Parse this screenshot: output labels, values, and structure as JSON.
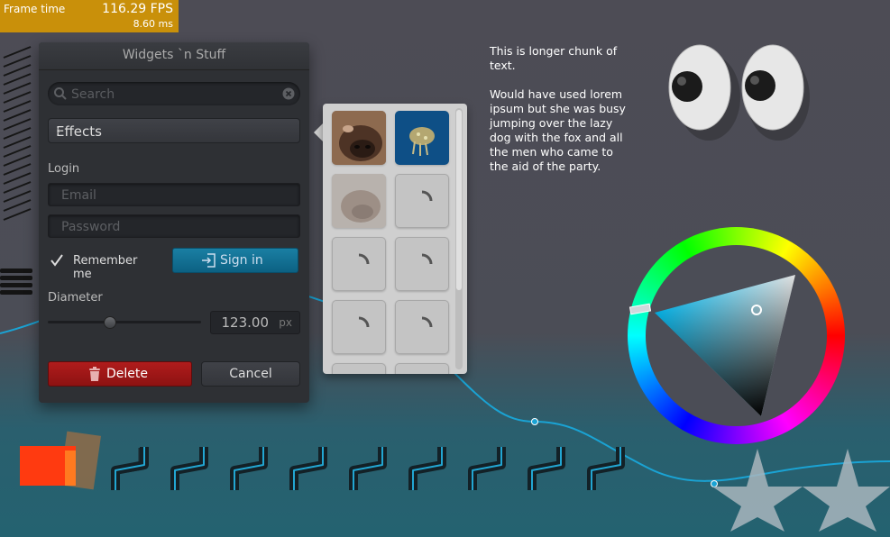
{
  "fps": {
    "label": "Frame time",
    "value": "116.29 FPS",
    "ms": "8.60 ms"
  },
  "window": {
    "title": "Widgets `n Stuff",
    "search_placeholder": "Search",
    "effects_label": "Effects",
    "login_label": "Login",
    "email_placeholder": "Email",
    "password_placeholder": "Password",
    "remember_label": "Remember me",
    "remember_checked": true,
    "signin_label": "Sign in",
    "diameter_label": "Diameter",
    "diameter_value": "123.00",
    "diameter_unit": "px",
    "diameter_slider_fraction": 0.4,
    "delete_label": "Delete",
    "cancel_label": "Cancel"
  },
  "text": {
    "para1": "This is longer chunk of text.",
    "para2": "Would have used lorem ipsum but she was busy jumping over the lazy dog with the fox and all the men who came to the aid of the party."
  },
  "colors": {
    "accent": "#0c6c91",
    "danger": "#a51717",
    "fps_bg": "#c9900a"
  }
}
